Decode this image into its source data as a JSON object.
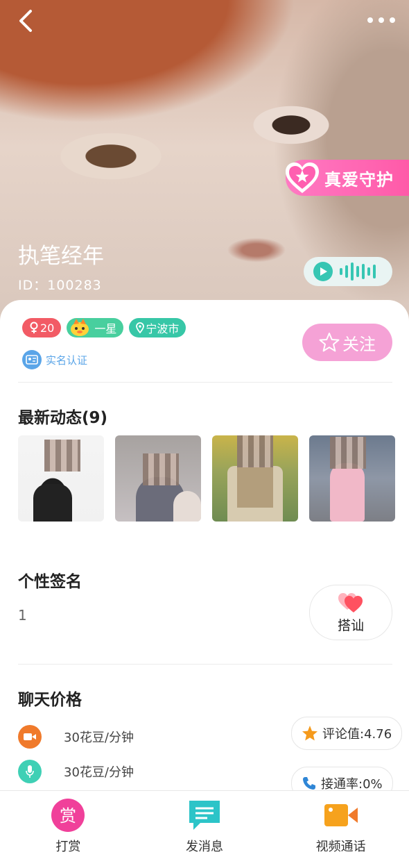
{
  "header": {
    "back_icon": "chevron-left-icon",
    "more_icon": "more-horizontal-icon",
    "guard_badge": "真爱守护",
    "nickname": "执笔经年",
    "user_id": "ID：100283"
  },
  "profile": {
    "age_tag": "20",
    "level_tag": "一星",
    "city_tag": "宁波市",
    "verify_label": "实名认证",
    "follow_label": "关注"
  },
  "moments": {
    "title": "最新动态(9)",
    "photo_count": 4
  },
  "signature": {
    "title": "个性签名",
    "text": "1",
    "chat_button": "搭讪"
  },
  "pricing": {
    "title": "聊天价格",
    "video_price": "30花豆/分钟",
    "voice_price": "30花豆/分钟",
    "rating": "评论值:4.76",
    "answer_rate": "接通率:0%"
  },
  "bottom_bar": {
    "tip": "打赏",
    "message": "发消息",
    "video_call": "视频通话"
  },
  "colors": {
    "accent_pink": "#ff5aa8",
    "teal": "#36c6b3",
    "follow_bg": "#f5a2d6",
    "video_icon": "#f07a2b",
    "voice_icon": "#3fd0b5"
  }
}
